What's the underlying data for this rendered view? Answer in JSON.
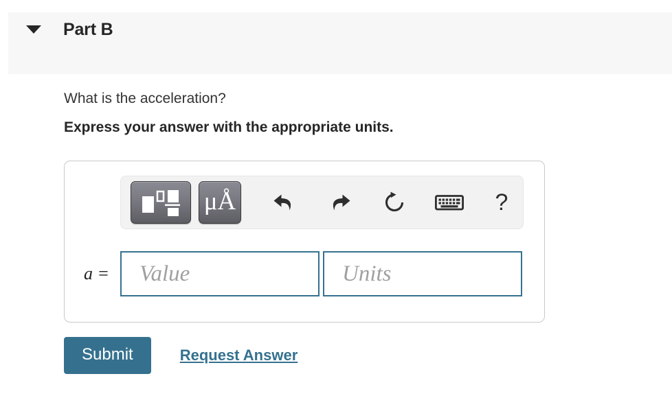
{
  "part": {
    "title": "Part B",
    "toggle_icon": "chevron-down-icon",
    "expanded": true
  },
  "question": {
    "prompt": "What is the acceleration?",
    "instruction": "Express your answer with the appropriate units."
  },
  "toolbar": {
    "buttons": [
      {
        "name": "math-template-button",
        "icon": "math-template-icon",
        "label": ""
      },
      {
        "name": "units-button",
        "icon": "units-icon",
        "label": "μÅ"
      },
      {
        "name": "undo-button",
        "icon": "undo-icon",
        "label": ""
      },
      {
        "name": "redo-button",
        "icon": "redo-icon",
        "label": ""
      },
      {
        "name": "reset-button",
        "icon": "reset-icon",
        "label": ""
      },
      {
        "name": "keyboard-button",
        "icon": "keyboard-icon",
        "label": ""
      },
      {
        "name": "help-button",
        "icon": "question-mark-icon",
        "label": "?"
      }
    ],
    "units_label": "μÅ",
    "help_label": "?"
  },
  "answer": {
    "variable_label": "a =",
    "value_field": {
      "value": "",
      "placeholder": "Value"
    },
    "units_field": {
      "value": "",
      "placeholder": "Units"
    }
  },
  "actions": {
    "submit_label": "Submit",
    "request_answer_label": "Request Answer"
  },
  "colors": {
    "accent": "#35718f",
    "header_band": "#f7f7f7",
    "panel_border": "#c9c9c9",
    "toolbar_background": "#f2f2f2",
    "text": "#333333"
  }
}
